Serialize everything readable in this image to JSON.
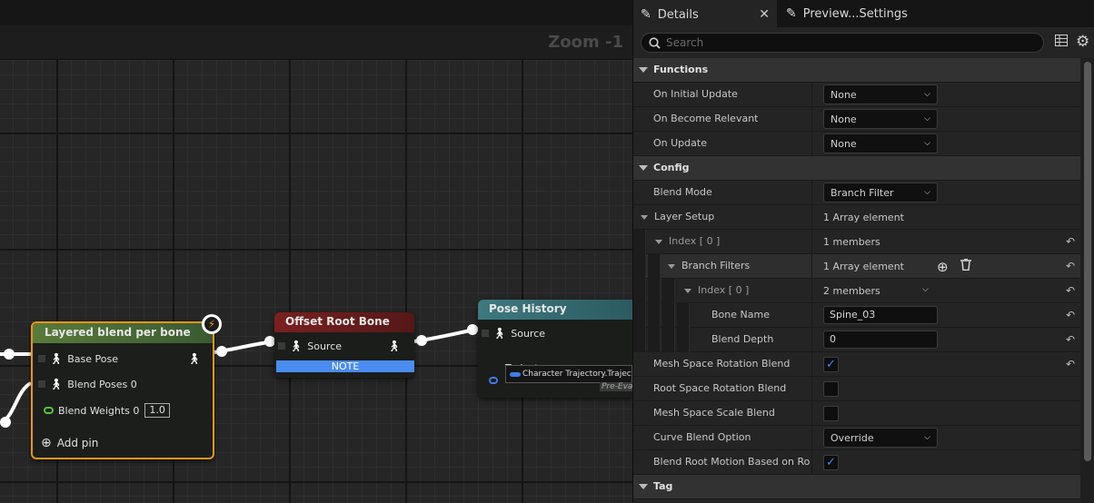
{
  "graph": {
    "zoom_label": "Zoom -1",
    "nodes": {
      "layered": {
        "title": "Layered blend per bone",
        "base_pose": "Base Pose",
        "blend_poses": "Blend Poses 0",
        "blend_weights": "Blend Weights 0",
        "blend_weight_value": "1.0",
        "add_pin": "Add pin"
      },
      "offset": {
        "title": "Offset Root Bone",
        "source": "Source",
        "note": "NOTE"
      },
      "pose_history": {
        "title": "Pose History",
        "source": "Source",
        "trajectory": "Trajectory",
        "trajectory_value": "Character Trajectory.Trajectory",
        "pre_eval": "Pre-Eval"
      }
    }
  },
  "panel": {
    "tabs": {
      "details": "Details",
      "preview": "Preview...Settings"
    },
    "search_placeholder": "Search",
    "categories": {
      "functions": "Functions",
      "config": "Config",
      "tag": "Tag"
    },
    "functions": {
      "on_initial_update": {
        "label": "On Initial Update",
        "value": "None"
      },
      "on_become_relevant": {
        "label": "On Become Relevant",
        "value": "None"
      },
      "on_update": {
        "label": "On Update",
        "value": "None"
      }
    },
    "config": {
      "blend_mode": {
        "label": "Blend Mode",
        "value": "Branch Filter"
      },
      "layer_setup": {
        "label": "Layer Setup",
        "value": "1 Array element"
      },
      "index0": {
        "label": "Index [ 0 ]",
        "value": "1 members"
      },
      "branch_filters": {
        "label": "Branch Filters",
        "value": "1 Array element"
      },
      "index0_inner": {
        "label": "Index [ 0 ]",
        "value": "2 members"
      },
      "bone_name": {
        "label": "Bone Name",
        "value": "Spine_03"
      },
      "blend_depth": {
        "label": "Blend Depth",
        "value": "0"
      },
      "mesh_space_rotation_blend": {
        "label": "Mesh Space Rotation Blend",
        "checked": true
      },
      "root_space_rotation_blend": {
        "label": "Root Space Rotation Blend",
        "checked": false
      },
      "mesh_space_scale_blend": {
        "label": "Mesh Space Scale Blend",
        "checked": false
      },
      "curve_blend_option": {
        "label": "Curve Blend Option",
        "value": "Override"
      },
      "blend_root_motion": {
        "label": "Blend Root Motion Based on Roo...",
        "checked": true
      }
    },
    "colors": {
      "accent": "#3b8cf0",
      "selection_border": "#e8961e"
    }
  }
}
